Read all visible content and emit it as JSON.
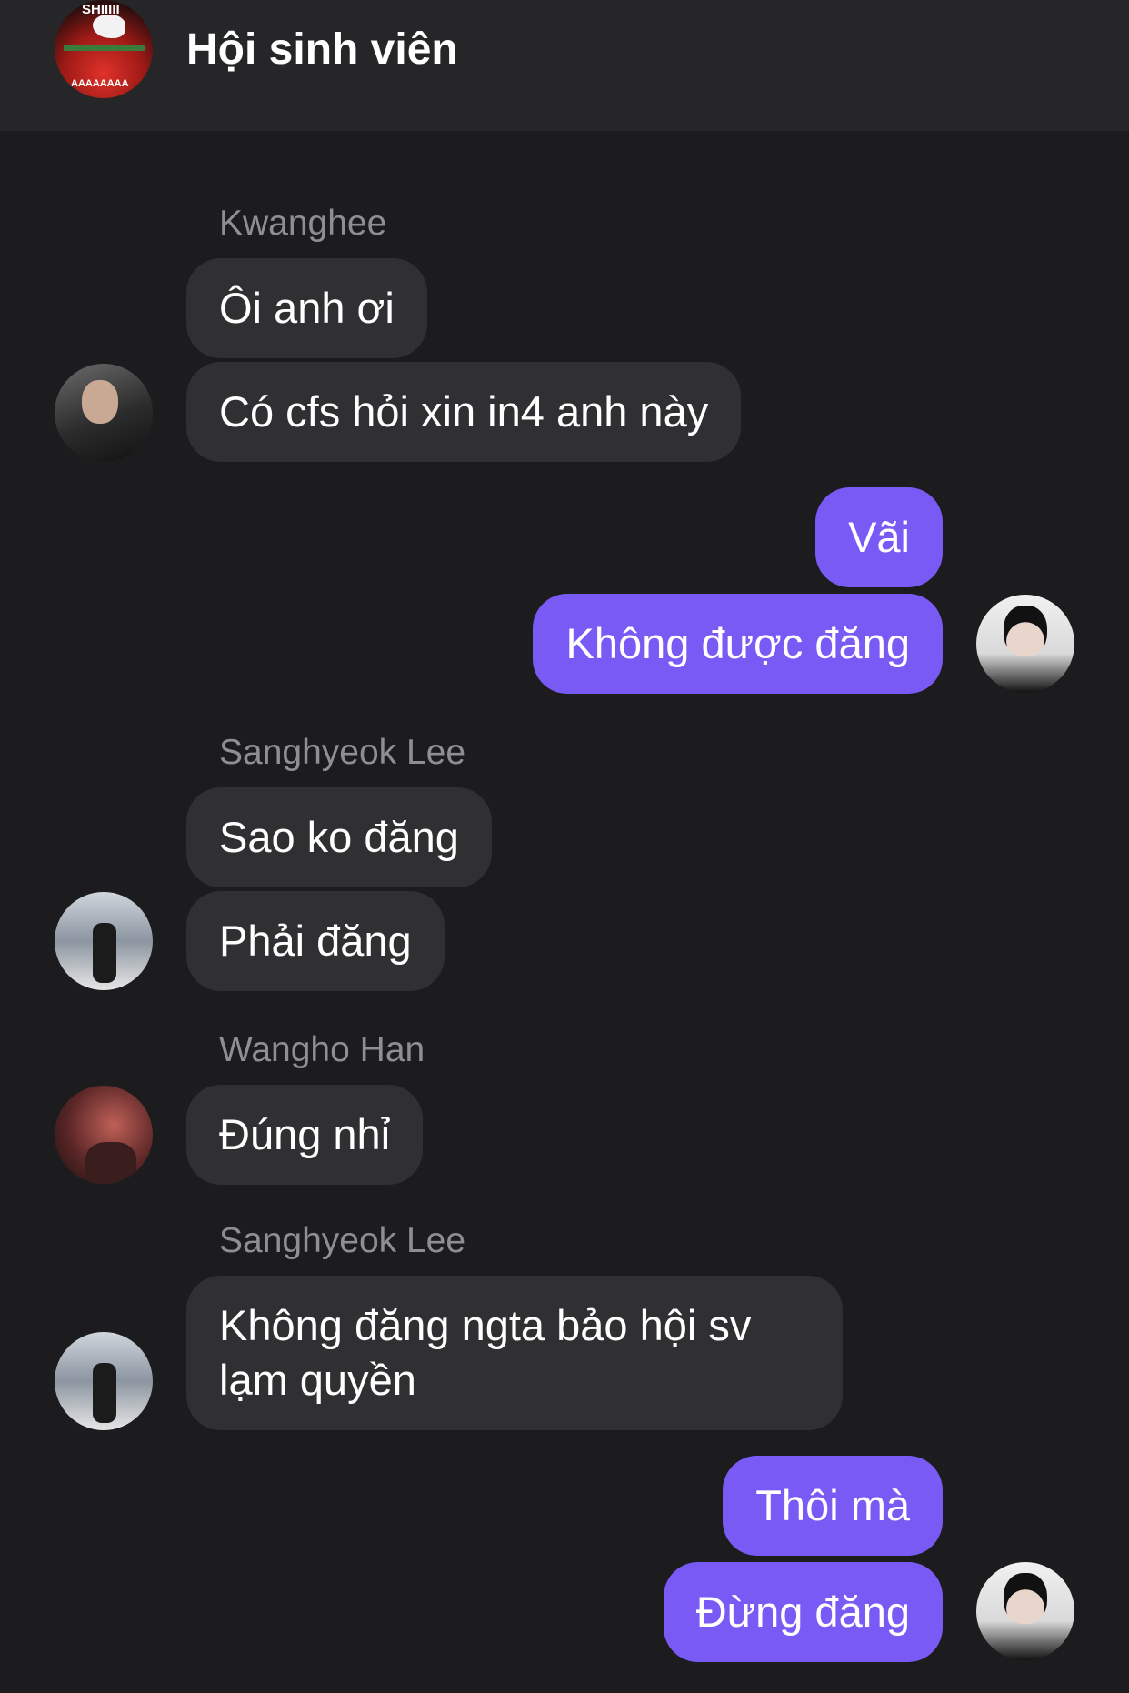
{
  "header": {
    "title": "Hội sinh viên",
    "group_avatar_top_text": "SHIIIII",
    "group_avatar_bottom_text": "AAAAAAAA"
  },
  "colors": {
    "background": "#1c1c1e",
    "header": "#262628",
    "incoming_bubble": "#303033",
    "outgoing_bubble": "#7a5af5",
    "sender_name": "#8e8e93"
  },
  "messages": [
    {
      "sender": "Kwanghee",
      "text": "Ôi anh ơi",
      "direction": "incoming"
    },
    {
      "sender": "Kwanghee",
      "text": "Có cfs hỏi xin in4 anh này",
      "direction": "incoming"
    },
    {
      "sender": "me",
      "text": "Vãi",
      "direction": "outgoing"
    },
    {
      "sender": "me",
      "text": "Không được đăng",
      "direction": "outgoing"
    },
    {
      "sender": "Sanghyeok Lee",
      "text": "Sao ko đăng",
      "direction": "incoming"
    },
    {
      "sender": "Sanghyeok Lee",
      "text": "Phải đăng",
      "direction": "incoming"
    },
    {
      "sender": "Wangho Han",
      "text": "Đúng nhỉ",
      "direction": "incoming"
    },
    {
      "sender": "Sanghyeok Lee",
      "text": "Không đăng ngta bảo hội sv lạm quyền",
      "direction": "incoming"
    },
    {
      "sender": "me",
      "text": "Thôi mà",
      "direction": "outgoing"
    },
    {
      "sender": "me",
      "text": "Đừng đăng",
      "direction": "outgoing"
    }
  ],
  "sender_labels": [
    "Kwanghee",
    "Sanghyeok Lee",
    "Wangho Han",
    "Sanghyeok Lee"
  ]
}
